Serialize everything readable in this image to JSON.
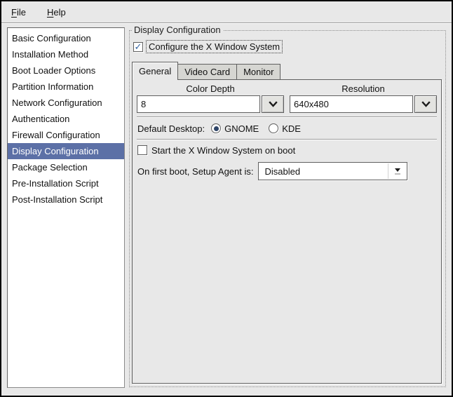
{
  "menubar": {
    "items": [
      {
        "label": "File"
      },
      {
        "label": "Help"
      }
    ]
  },
  "sidebar": {
    "selected_index": 7,
    "items": [
      "Basic Configuration",
      "Installation Method",
      "Boot Loader Options",
      "Partition Information",
      "Network Configuration",
      "Authentication",
      "Firewall Configuration",
      "Display Configuration",
      "Package Selection",
      "Pre-Installation Script",
      "Post-Installation Script"
    ]
  },
  "panel": {
    "frame_title": "Display Configuration",
    "configure_checkbox": {
      "label": "Configure the X Window System",
      "checked": true
    },
    "tabs": [
      {
        "label": "General",
        "active": true
      },
      {
        "label": "Video Card",
        "active": false
      },
      {
        "label": "Monitor",
        "active": false
      }
    ],
    "general": {
      "color_depth": {
        "label": "Color Depth",
        "value": "8"
      },
      "resolution": {
        "label": "Resolution",
        "value": "640x480"
      },
      "default_desktop": {
        "label": "Default Desktop:",
        "options": [
          {
            "label": "GNOME",
            "selected": true
          },
          {
            "label": "KDE",
            "selected": false
          }
        ]
      },
      "start_x_checkbox": {
        "label": "Start the X Window System on boot",
        "checked": false
      },
      "setup_agent": {
        "label": "On first boot, Setup Agent is:",
        "value": "Disabled"
      }
    }
  },
  "colors": {
    "selection_bg": "#5c70a6",
    "check_blue": "#3465a4",
    "radio_dot": "#2e4467",
    "frame_bg": "#e8e8e8"
  }
}
